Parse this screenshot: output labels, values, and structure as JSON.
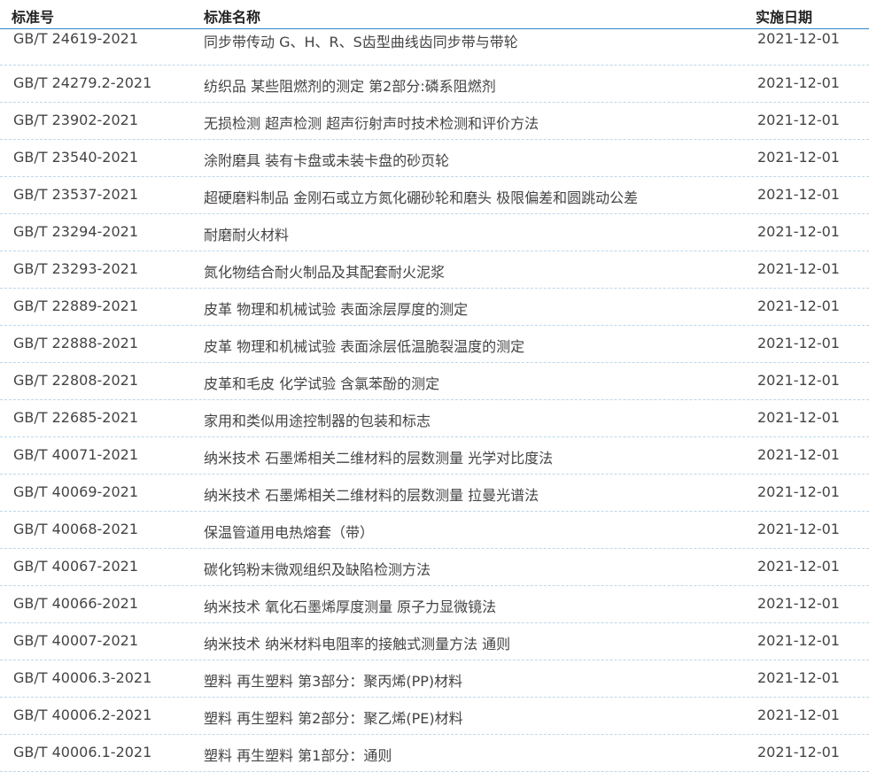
{
  "table": {
    "headers": {
      "code": "标准号",
      "name": "标准名称",
      "date": "实施日期"
    },
    "rows": [
      {
        "code": "GB/T 24619-2021",
        "name": "同步带传动 G、H、R、S齿型曲线齿同步带与带轮",
        "date": "2021-12-01"
      },
      {
        "code": "GB/T 24279.2-2021",
        "name": "纺织品 某些阻燃剂的测定 第2部分:磷系阻燃剂",
        "date": "2021-12-01"
      },
      {
        "code": "GB/T 23902-2021",
        "name": "无损检测 超声检测 超声衍射声时技术检测和评价方法",
        "date": "2021-12-01"
      },
      {
        "code": "GB/T 23540-2021",
        "name": "涂附磨具 装有卡盘或未装卡盘的砂页轮",
        "date": "2021-12-01"
      },
      {
        "code": "GB/T 23537-2021",
        "name": "超硬磨料制品 金刚石或立方氮化硼砂轮和磨头 极限偏差和圆跳动公差",
        "date": "2021-12-01"
      },
      {
        "code": "GB/T 23294-2021",
        "name": "耐磨耐火材料",
        "date": "2021-12-01"
      },
      {
        "code": "GB/T 23293-2021",
        "name": "氮化物结合耐火制品及其配套耐火泥浆",
        "date": "2021-12-01"
      },
      {
        "code": "GB/T 22889-2021",
        "name": "皮革 物理和机械试验 表面涂层厚度的测定",
        "date": "2021-12-01"
      },
      {
        "code": "GB/T 22888-2021",
        "name": "皮革 物理和机械试验 表面涂层低温脆裂温度的测定",
        "date": "2021-12-01"
      },
      {
        "code": "GB/T 22808-2021",
        "name": "皮革和毛皮 化学试验 含氯苯酚的测定",
        "date": "2021-12-01"
      },
      {
        "code": "GB/T 22685-2021",
        "name": "家用和类似用途控制器的包装和标志",
        "date": "2021-12-01"
      },
      {
        "code": "GB/T 40071-2021",
        "name": "纳米技术 石墨烯相关二维材料的层数测量 光学对比度法",
        "date": "2021-12-01"
      },
      {
        "code": "GB/T 40069-2021",
        "name": "纳米技术 石墨烯相关二维材料的层数测量 拉曼光谱法",
        "date": "2021-12-01"
      },
      {
        "code": "GB/T 40068-2021",
        "name": "保温管道用电热熔套（带）",
        "date": "2021-12-01"
      },
      {
        "code": "GB/T 40067-2021",
        "name": "碳化钨粉末微观组织及缺陷检测方法",
        "date": "2021-12-01"
      },
      {
        "code": "GB/T 40066-2021",
        "name": "纳米技术 氧化石墨烯厚度测量 原子力显微镜法",
        "date": "2021-12-01"
      },
      {
        "code": "GB/T 40007-2021",
        "name": "纳米技术 纳米材料电阻率的接触式测量方法 通则",
        "date": "2021-12-01"
      },
      {
        "code": "GB/T 40006.3-2021",
        "name": "塑料 再生塑料 第3部分：聚丙烯(PP)材料",
        "date": "2021-12-01"
      },
      {
        "code": "GB/T 40006.2-2021",
        "name": "塑料 再生塑料 第2部分：聚乙烯(PE)材料",
        "date": "2021-12-01"
      },
      {
        "code": "GB/T 40006.1-2021",
        "name": "塑料 再生塑料 第1部分：通则",
        "date": "2021-12-01"
      }
    ]
  }
}
